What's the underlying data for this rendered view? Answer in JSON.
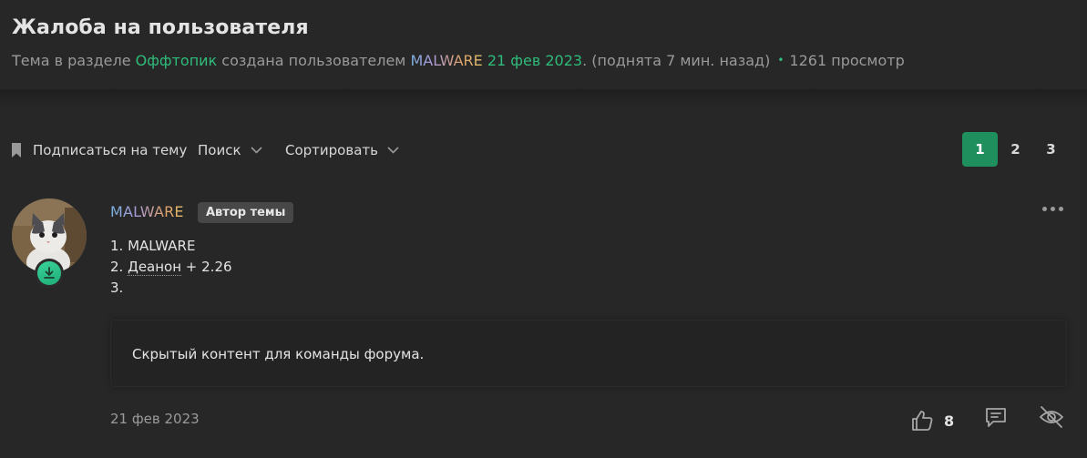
{
  "thread": {
    "title": "Жалоба на пользователя",
    "meta": {
      "prefix": "Тема в разделе ",
      "section": "Оффтопик",
      "created_by": " создана пользователем ",
      "author": "MALWARE",
      "date": " 21 фев 2023",
      "bumped": ". (поднята 7 мин. назад)",
      "views": "1261 просмотр"
    }
  },
  "toolbar": {
    "subscribe_label": "Подписаться на тему",
    "search_label": "Поиск",
    "sort_label": "Сортировать",
    "pages": [
      "1",
      "2",
      "3"
    ],
    "current_page": "1"
  },
  "post": {
    "author": "MALWARE",
    "author_badge": "Автор темы",
    "lines": {
      "l1": "1. MALWARE",
      "l2_prefix": "2. ",
      "l2_link": "Деанон",
      "l2_suffix": " + 2.26",
      "l3": "3."
    },
    "hidden_text": "Скрытый контент для команды форума.",
    "date": "21 фев 2023",
    "likes": "8"
  },
  "icons": {
    "bookmark": "bookmark-icon",
    "chevron": "chevron-down-icon",
    "more": "more-dots-icon",
    "like": "thumbs-up-icon",
    "reply": "comment-icon",
    "hide": "eye-off-icon",
    "badge": "download-icon"
  },
  "colors": {
    "accent": "#1f8f5e",
    "link": "#2fbb7a"
  }
}
